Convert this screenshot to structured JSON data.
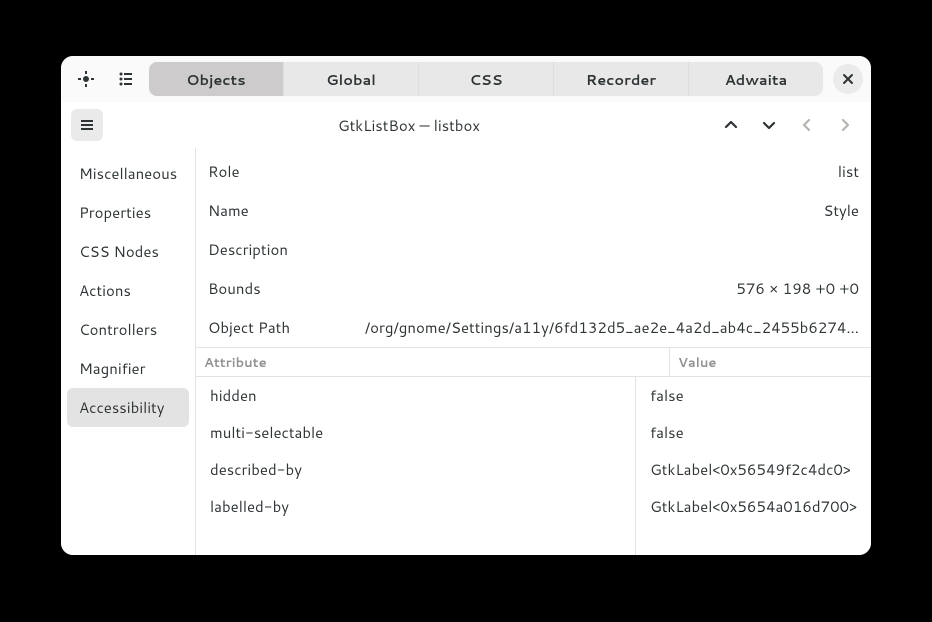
{
  "header": {
    "tabs": [
      {
        "label": "Objects",
        "active": true
      },
      {
        "label": "Global",
        "active": false
      },
      {
        "label": "CSS",
        "active": false
      },
      {
        "label": "Recorder",
        "active": false
      },
      {
        "label": "Adwaita",
        "active": false
      }
    ]
  },
  "subheader": {
    "title": "GtkListBox — listbox"
  },
  "sidebar": {
    "items": [
      {
        "label": "Miscellaneous",
        "selected": false
      },
      {
        "label": "Properties",
        "selected": false
      },
      {
        "label": "CSS Nodes",
        "selected": false
      },
      {
        "label": "Actions",
        "selected": false
      },
      {
        "label": "Controllers",
        "selected": false
      },
      {
        "label": "Magnifier",
        "selected": false
      },
      {
        "label": "Accessibility",
        "selected": true
      }
    ]
  },
  "properties": [
    {
      "key": "Role",
      "value": "list"
    },
    {
      "key": "Name",
      "value": "Style"
    },
    {
      "key": "Description",
      "value": ""
    },
    {
      "key": "Bounds",
      "value": "576 × 198 +0 +0"
    },
    {
      "key": "Object Path",
      "value": "/org/gnome/Settings/a11y/6fd132d5_ae2e_4a2d_ab4c_2455b6274…"
    }
  ],
  "attributes": {
    "header": {
      "attribute": "Attribute",
      "value": "Value"
    },
    "rows": [
      {
        "attribute": "hidden",
        "value": "false"
      },
      {
        "attribute": "multi-selectable",
        "value": "false"
      },
      {
        "attribute": "described-by",
        "value": "GtkLabel<0x56549f2c4dc0>"
      },
      {
        "attribute": "labelled-by",
        "value": "GtkLabel<0x5654a016d700>"
      }
    ]
  }
}
